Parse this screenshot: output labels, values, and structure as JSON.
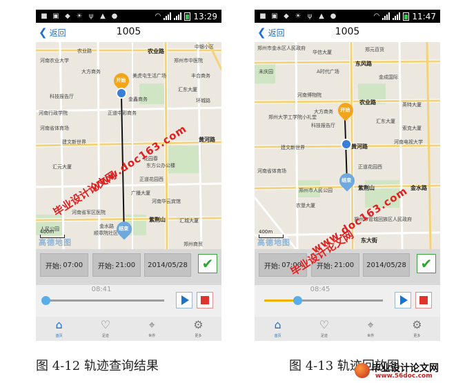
{
  "status_bar": [
    {
      "time": "13:29"
    },
    {
      "time": "11:47"
    }
  ],
  "screens": [
    {
      "back_label": "返回",
      "title": "1005",
      "start_label": "开始:",
      "start_time": "07:00",
      "end_label": "开始:",
      "end_time": "21:00",
      "date": "2014/05/28",
      "playback_time": "08:41",
      "progress": 0.0,
      "map_pin_start": "开始",
      "map_pin_end": "结束",
      "scale": "400m",
      "map_brand": "高德地图",
      "map_labels": [
        "农业路",
        "河南农业大学",
        "农业路",
        "中银小区",
        "大方商务",
        "郑州市中医院",
        "美虎屯生活广场",
        "丰合商务",
        "金鑫商务",
        "科技报告厅",
        "汇东大厦",
        "河南行政学院",
        "正道中彩商务",
        "环城路",
        "建文新世界",
        "黄河路",
        "河南省体育场",
        "汇元大厦",
        "花园春",
        "东方公办公楼",
        "正道花园西",
        "广播大厦",
        "河南省军区医院",
        "紫荆山",
        "河南华云宾馆",
        "汇城大厦",
        "人民公园",
        "顺章院社区",
        "金水路",
        "郑州商贸"
      ],
      "caption": "图 4-12 轨迹查询结果"
    },
    {
      "back_label": "返回",
      "title": "1005",
      "start_label": "开始:",
      "start_time": "07:00",
      "end_label": "开始:",
      "end_time": "21:00",
      "date": "2014/05/28",
      "playback_time": "08:45",
      "progress": 0.28,
      "map_pin_start": "开始",
      "map_pin_end": "结束",
      "scale": "400m",
      "map_brand": "高德地图",
      "map_labels": [
        "郑州市金水区人民政府",
        "华信大厦",
        "郑元百货",
        "东风路",
        "未庆园",
        "A时代广场",
        "金成国际",
        "河南博物院",
        "农业路",
        "英特大厦",
        "郑州大学工学院小礼堂",
        "大方商务",
        "汇东大厦",
        "科技报告厅",
        "索克大厦",
        "建文新世界",
        "黄河路",
        "河南电视大学",
        "正道花园西",
        "河南省体育场",
        "紫荆山",
        "郑州市人民公园",
        "农垦大厦",
        "金水路",
        "郑州市管城回族区人民政府",
        "东大街"
      ],
      "caption": "图 4-13 轨迹回放图"
    }
  ],
  "nav_items": [
    {
      "label": "首页",
      "icon": "home-icon"
    },
    {
      "label": "足迹",
      "icon": "heart-icon"
    },
    {
      "label": "世界",
      "icon": "location-pin-icon"
    },
    {
      "label": "更多",
      "icon": "gear-icon"
    }
  ],
  "watermark": {
    "url": "www.doc163.com",
    "text": "毕业设计论文网"
  },
  "logo": {
    "text": "毕业设计论文网",
    "url": "www.56doc.com"
  },
  "colors": {
    "accent_blue": "#1e73c8",
    "check_green": "#2ea52e",
    "stop_red": "#e0332e",
    "start_pin": "#f2a51b",
    "end_pin": "#6fa8dc",
    "progress_fill": "#f0b400"
  }
}
